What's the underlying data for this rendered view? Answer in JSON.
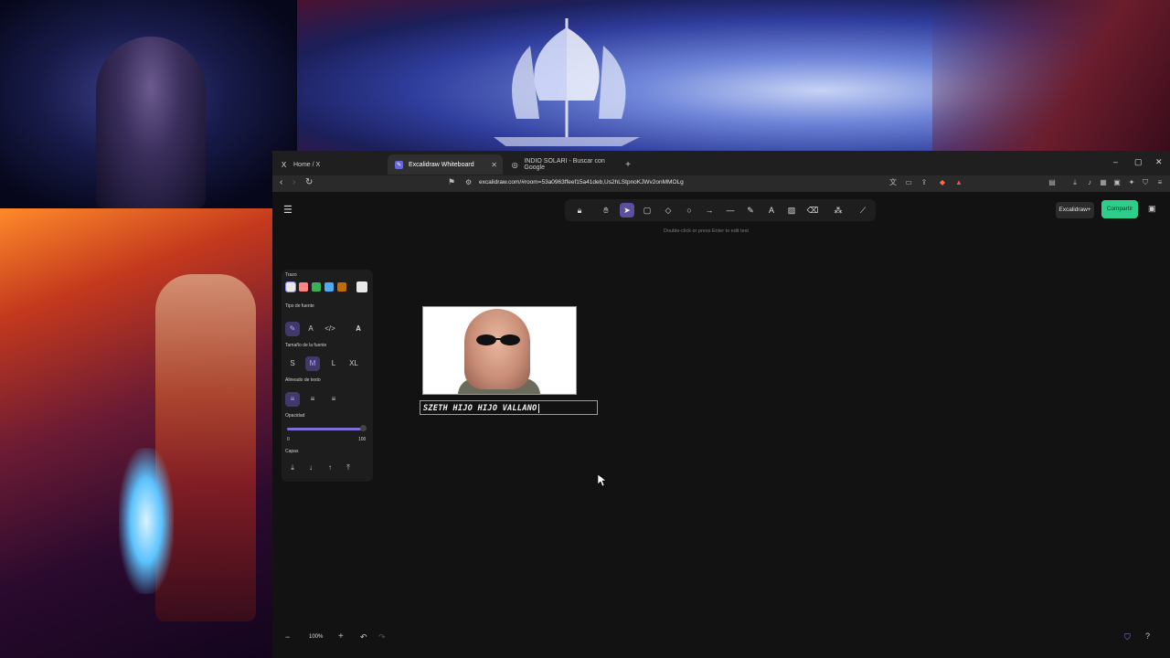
{
  "browser": {
    "tabs": [
      {
        "label": "Home / X",
        "icon": "x-logo-icon"
      },
      {
        "label": "Excalidraw Whiteboard",
        "icon": "excalidraw-logo-icon"
      },
      {
        "label": "INDIO SOLARI - Buscar con Google",
        "icon": "google-icon"
      }
    ],
    "url": "excalidraw.com/#room=53a0963ffeef15a41deb,Us2hLStpnoKJWv2onMMOLg"
  },
  "excalidraw": {
    "hint": "Double-click or press Enter to edit text",
    "plus_label": "Excalidraw+",
    "share_label": "Compartir",
    "panel": {
      "stroke_label": "Trazo",
      "font_family_label": "Tipo de fuente",
      "font_size_label": "Tamaño de la fuente",
      "size_options": [
        "S",
        "M",
        "L",
        "XL"
      ],
      "selected_size": "M",
      "text_align_label": "Alineado de texto",
      "opacity_label": "Opacidad",
      "opacity_min": "0",
      "opacity_max": "100",
      "opacity_value": 100,
      "layers_label": "Capas",
      "stroke_colors": [
        "#e9e9e9",
        "#ff8383",
        "#3ab05a",
        "#4dabf7",
        "#c26b09"
      ],
      "current_stroke_color": "#e9e9e9"
    },
    "text_element": "SZETH HIJO HIJO VALLANO",
    "zoom": "100%"
  }
}
